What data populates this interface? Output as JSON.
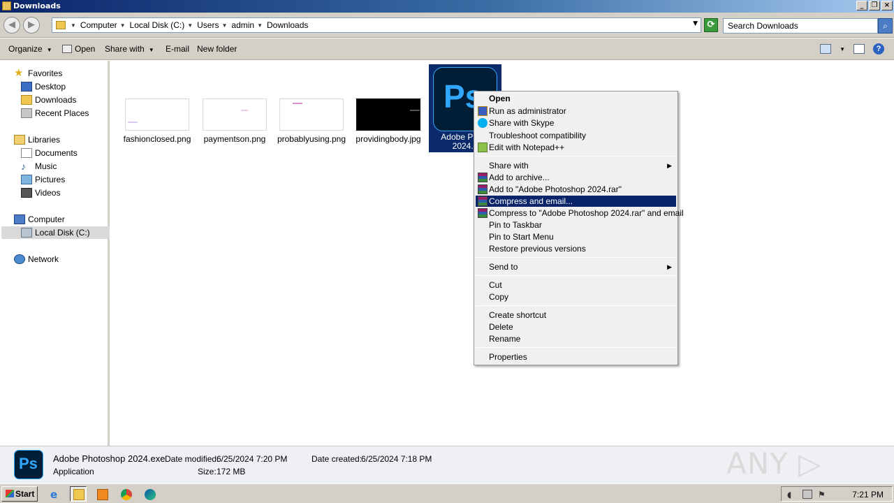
{
  "window": {
    "title": "Downloads"
  },
  "window_buttons": [
    "_",
    "❐",
    "×"
  ],
  "address": {
    "crumbs": [
      "Computer",
      "Local Disk (C:)",
      "Users",
      "admin",
      "Downloads"
    ],
    "search_placeholder": "Search Downloads"
  },
  "toolbar": {
    "organize": "Organize",
    "open": "Open",
    "share_with": "Share with",
    "email": "E-mail",
    "new_folder": "New folder"
  },
  "sidebar": {
    "favorites": "Favorites",
    "desktop": "Desktop",
    "downloads": "Downloads",
    "recent_places": "Recent Places",
    "libraries": "Libraries",
    "documents": "Documents",
    "music": "Music",
    "pictures": "Pictures",
    "videos": "Videos",
    "computer": "Computer",
    "local_disk": "Local Disk (C:)",
    "network": "Network"
  },
  "files": [
    {
      "name": "fashionclosed.png"
    },
    {
      "name": "paymentson.png"
    },
    {
      "name": "probablyusing.png"
    },
    {
      "name": "providingbody.jpg"
    },
    {
      "name": "Adobe Photoshop 2024.exe",
      "name_visible_line1": "Adobe Photo",
      "name_visible_line2": "2024.e"
    }
  ],
  "ps_icon_text": "Ps",
  "context_menu": {
    "open": "Open",
    "run_as_admin": "Run as administrator",
    "share_skype": "Share with Skype",
    "troubleshoot": "Troubleshoot compatibility",
    "edit_npp": "Edit with Notepad++",
    "share_with": "Share with",
    "add_archive": "Add to archive...",
    "add_rar": "Add to \"Adobe Photoshop 2024.rar\"",
    "compress_email": "Compress and email...",
    "compress_rar_email": "Compress to \"Adobe Photoshop 2024.rar\" and email",
    "pin_taskbar": "Pin to Taskbar",
    "pin_start": "Pin to Start Menu",
    "restore": "Restore previous versions",
    "send_to": "Send to",
    "cut": "Cut",
    "copy": "Copy",
    "create_shortcut": "Create shortcut",
    "delete": "Delete",
    "rename": "Rename",
    "properties": "Properties"
  },
  "details": {
    "name": "Adobe Photoshop 2024.exe",
    "type": "Application",
    "modified_label": "Date modified:",
    "modified_value": "6/25/2024 7:20 PM",
    "created_label": "Date created:",
    "created_value": "6/25/2024 7:18 PM",
    "size_label": "Size:",
    "size_value": "172 MB"
  },
  "watermark": "ANY ▷ RUN",
  "taskbar": {
    "start": "Start",
    "clock": "7:21 PM"
  },
  "colors": {
    "selection": "#0a246a",
    "ps_blue": "#31a8ff",
    "ps_bg": "#001e36"
  }
}
